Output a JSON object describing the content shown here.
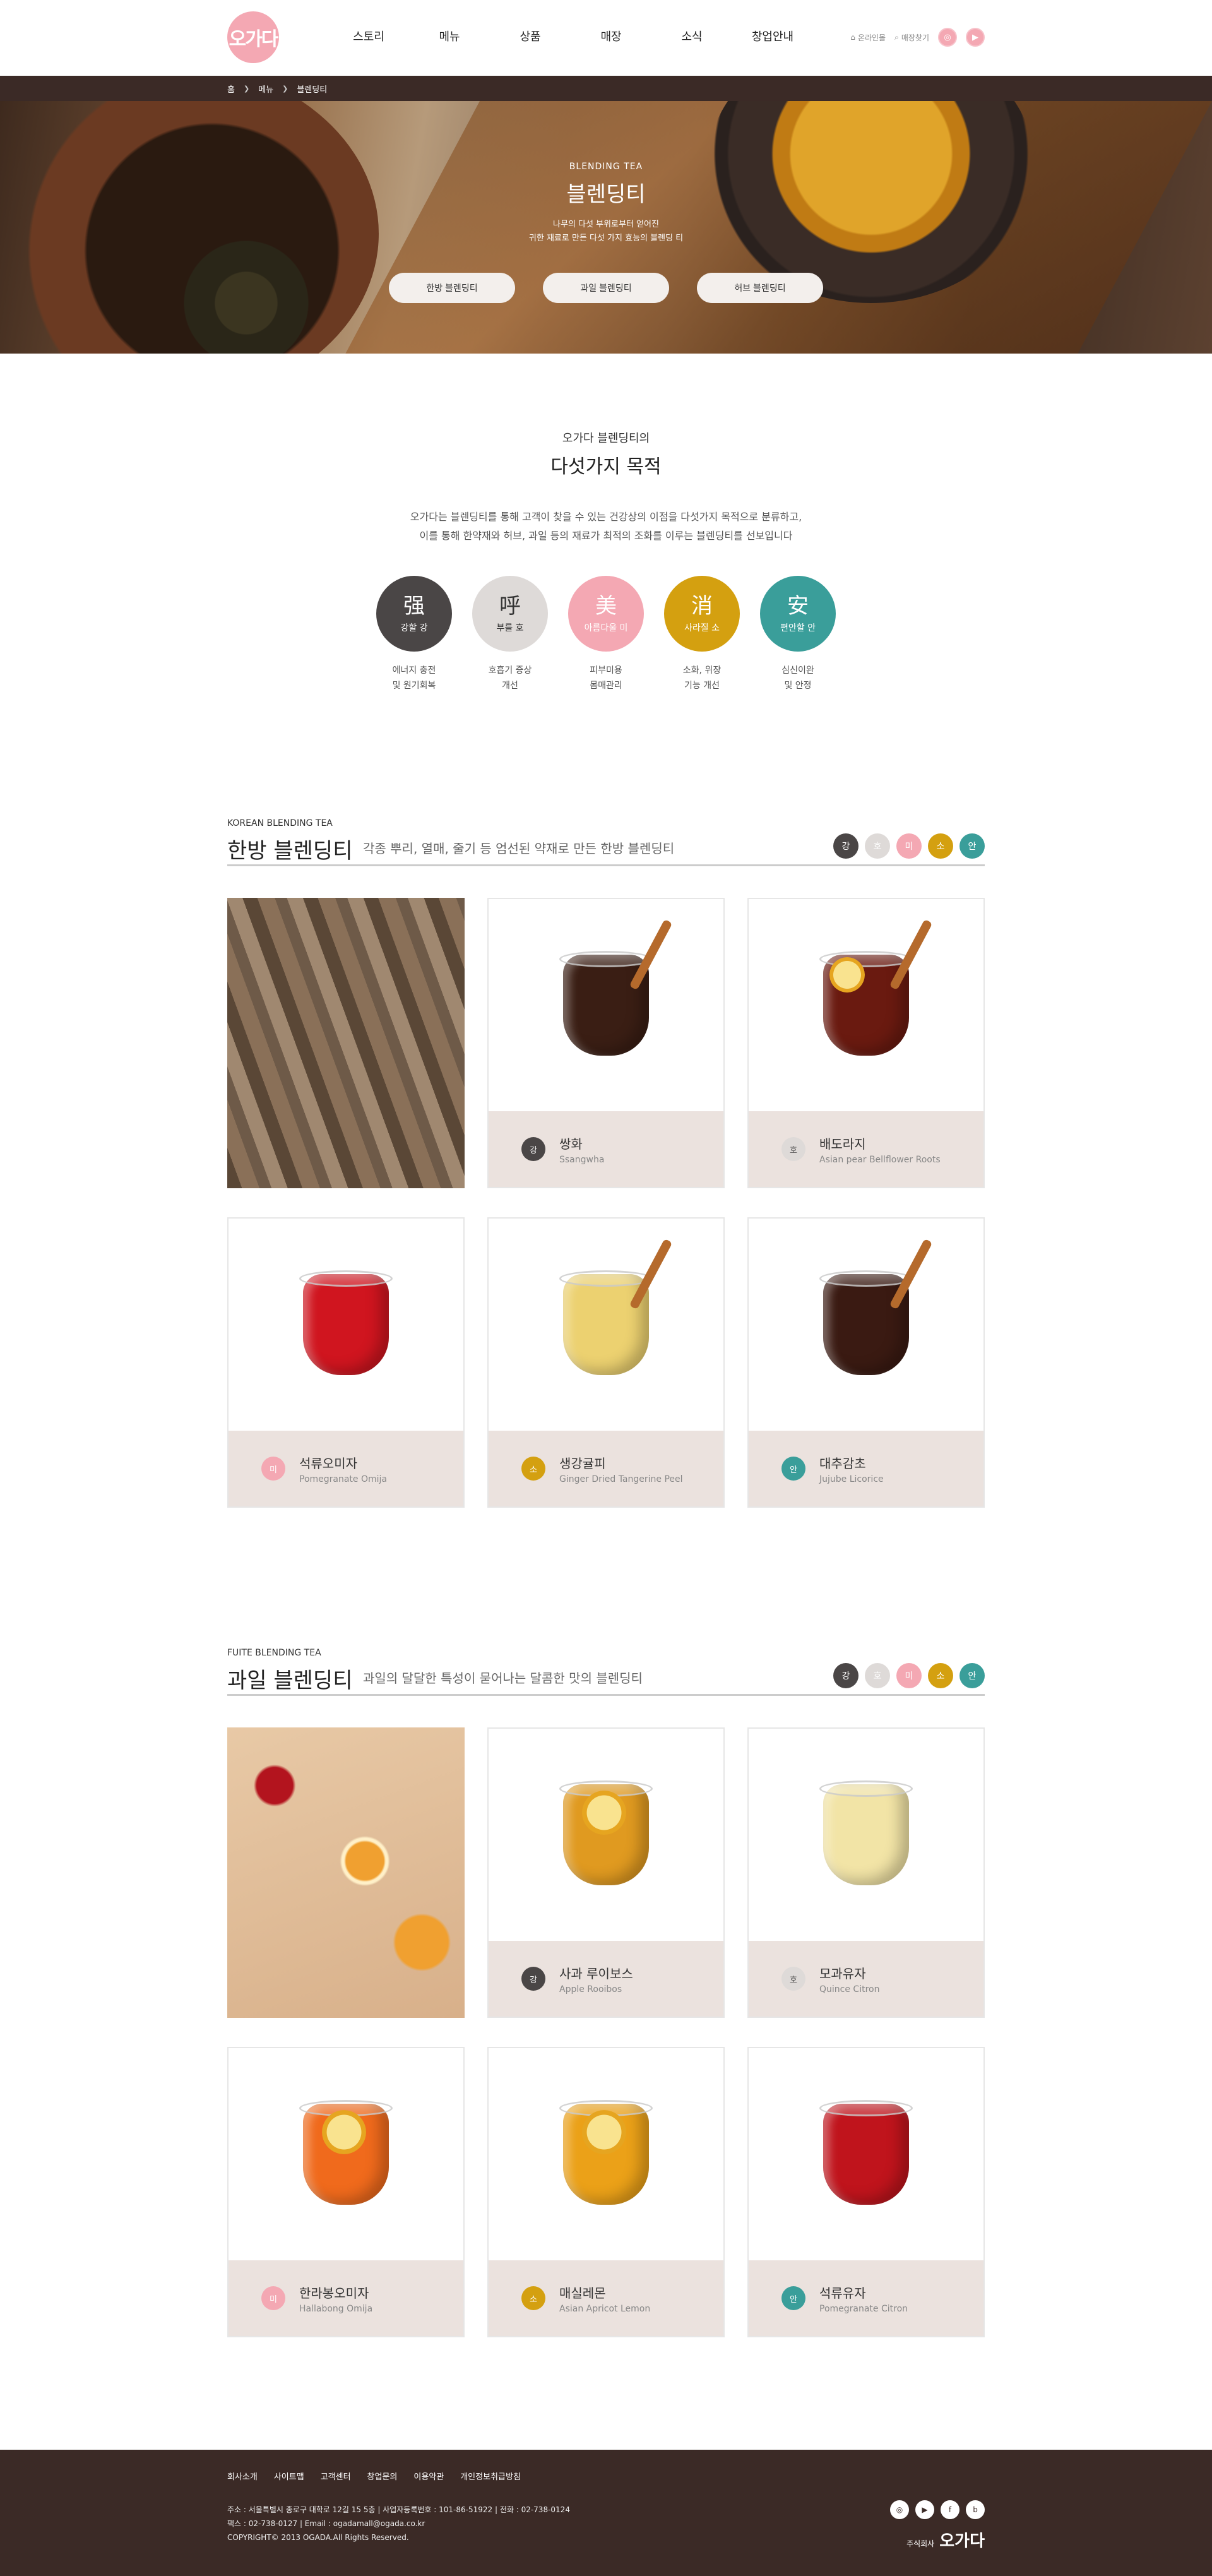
{
  "header": {
    "logo": "오가다",
    "nav": [
      "스토리",
      "메뉴",
      "상품",
      "매장",
      "소식",
      "창업안내"
    ],
    "util_online": "온라인몰",
    "util_search": "매장찾기",
    "sns": [
      "instagram-icon",
      "youtube-icon"
    ]
  },
  "breadcrumb": [
    "홈",
    "메뉴",
    "블렌딩티"
  ],
  "hero": {
    "en": "BLENDING TEA",
    "title": "블렌딩티",
    "desc1": "나무의 다섯 부위로부터 얻어진",
    "desc2": "귀한 재료로 만든 다섯 가지 효능의 블렌딩 티",
    "buttons": [
      "한방 블렌딩티",
      "과일 블렌딩티",
      "허브 블렌딩티"
    ]
  },
  "purpose": {
    "sub": "오가다 블렌딩티의",
    "title": "다섯가지 목적",
    "desc1": "오가다는 블렌딩티를 통해 고객이 찾을 수 있는 건강상의 이점을 다섯가지 목적으로 분류하고,",
    "desc2": "이를 통해 한약재와 허브, 과일 등의 재료가 최적의 조화를 이루는 블렌딩티를 선보입니다",
    "items": [
      {
        "han": "强",
        "kor": "강할 강",
        "cap1": "에너지 충전",
        "cap2": "및 원기회복",
        "color": "#4a4646"
      },
      {
        "han": "呼",
        "kor": "부를 호",
        "cap1": "호흡기 증상",
        "cap2": "개선",
        "color": "#dedad8",
        "dark": true
      },
      {
        "han": "美",
        "kor": "아름다울 미",
        "cap1": "피부미용",
        "cap2": "몸매관리",
        "color": "#f4a8b3"
      },
      {
        "han": "消",
        "kor": "사라질 소",
        "cap1": "소화, 위장",
        "cap2": "기능 개선",
        "color": "#d4a010"
      },
      {
        "han": "安",
        "kor": "편안할 안",
        "cap1": "심신이완",
        "cap2": "및 안정",
        "color": "#3a9e9a"
      }
    ]
  },
  "colors": {
    "gang": "#4a4646",
    "ho": "#dedad8",
    "mi": "#f4a8b3",
    "so": "#d4a010",
    "an": "#3a9e9a"
  },
  "dots": [
    "강",
    "호",
    "미",
    "소",
    "안"
  ],
  "korean": {
    "en": "KOREAN BLENDING TEA",
    "title": "한방 블렌딩티",
    "desc": "각종 뿌리, 열매, 줄기 등 엄선된 약재로 만든 한방 블렌딩티",
    "items": [
      {
        "tag": "강",
        "name": "쌍화",
        "eng": "Ssangwha"
      },
      {
        "tag": "호",
        "name": "배도라지",
        "eng": "Asian pear Bellflower Roots"
      },
      {
        "tag": "미",
        "name": "석류오미자",
        "eng": "Pomegranate Omija"
      },
      {
        "tag": "소",
        "name": "생강귤피",
        "eng": "Ginger Dried Tangerine Peel"
      },
      {
        "tag": "안",
        "name": "대추감초",
        "eng": "Jujube Licorice"
      }
    ]
  },
  "fruit": {
    "en": "FUITE BLENDING TEA",
    "title": "과일 블렌딩티",
    "desc": "과일의 달달한 특성이 묻어나는 달콤한 맛의 블렌딩티",
    "items": [
      {
        "tag": "강",
        "name": "사과 루이보스",
        "eng": "Apple Rooibos"
      },
      {
        "tag": "호",
        "name": "모과유자",
        "eng": "Quince Citron"
      },
      {
        "tag": "미",
        "name": "한라봉오미자",
        "eng": "Hallabong Omija"
      },
      {
        "tag": "소",
        "name": "매실레몬",
        "eng": "Asian Apricot Lemon"
      },
      {
        "tag": "안",
        "name": "석류유자",
        "eng": "Pomegranate Citron"
      }
    ]
  },
  "footer": {
    "links": [
      "회사소개",
      "사이트맵",
      "고객센터",
      "창업문의",
      "이용약관",
      "개인정보취급방침"
    ],
    "addr": "주소 : 서울특별시 종로구 대학로 12길 15 5층  |  사업자등록번호 : 101-86-51922  |  전화 : 02-738-0124",
    "fax": "팩스 : 02-738-0127  |  Email : ogadamall@ogada.co.kr",
    "copy": "COPYRIGHT© 2013 OGADA.All Rights Reserved.",
    "brand_small": "주식회사",
    "brand": "오가다",
    "sns": [
      "instagram-icon",
      "youtube-icon",
      "facebook-icon",
      "blog-icon"
    ]
  }
}
